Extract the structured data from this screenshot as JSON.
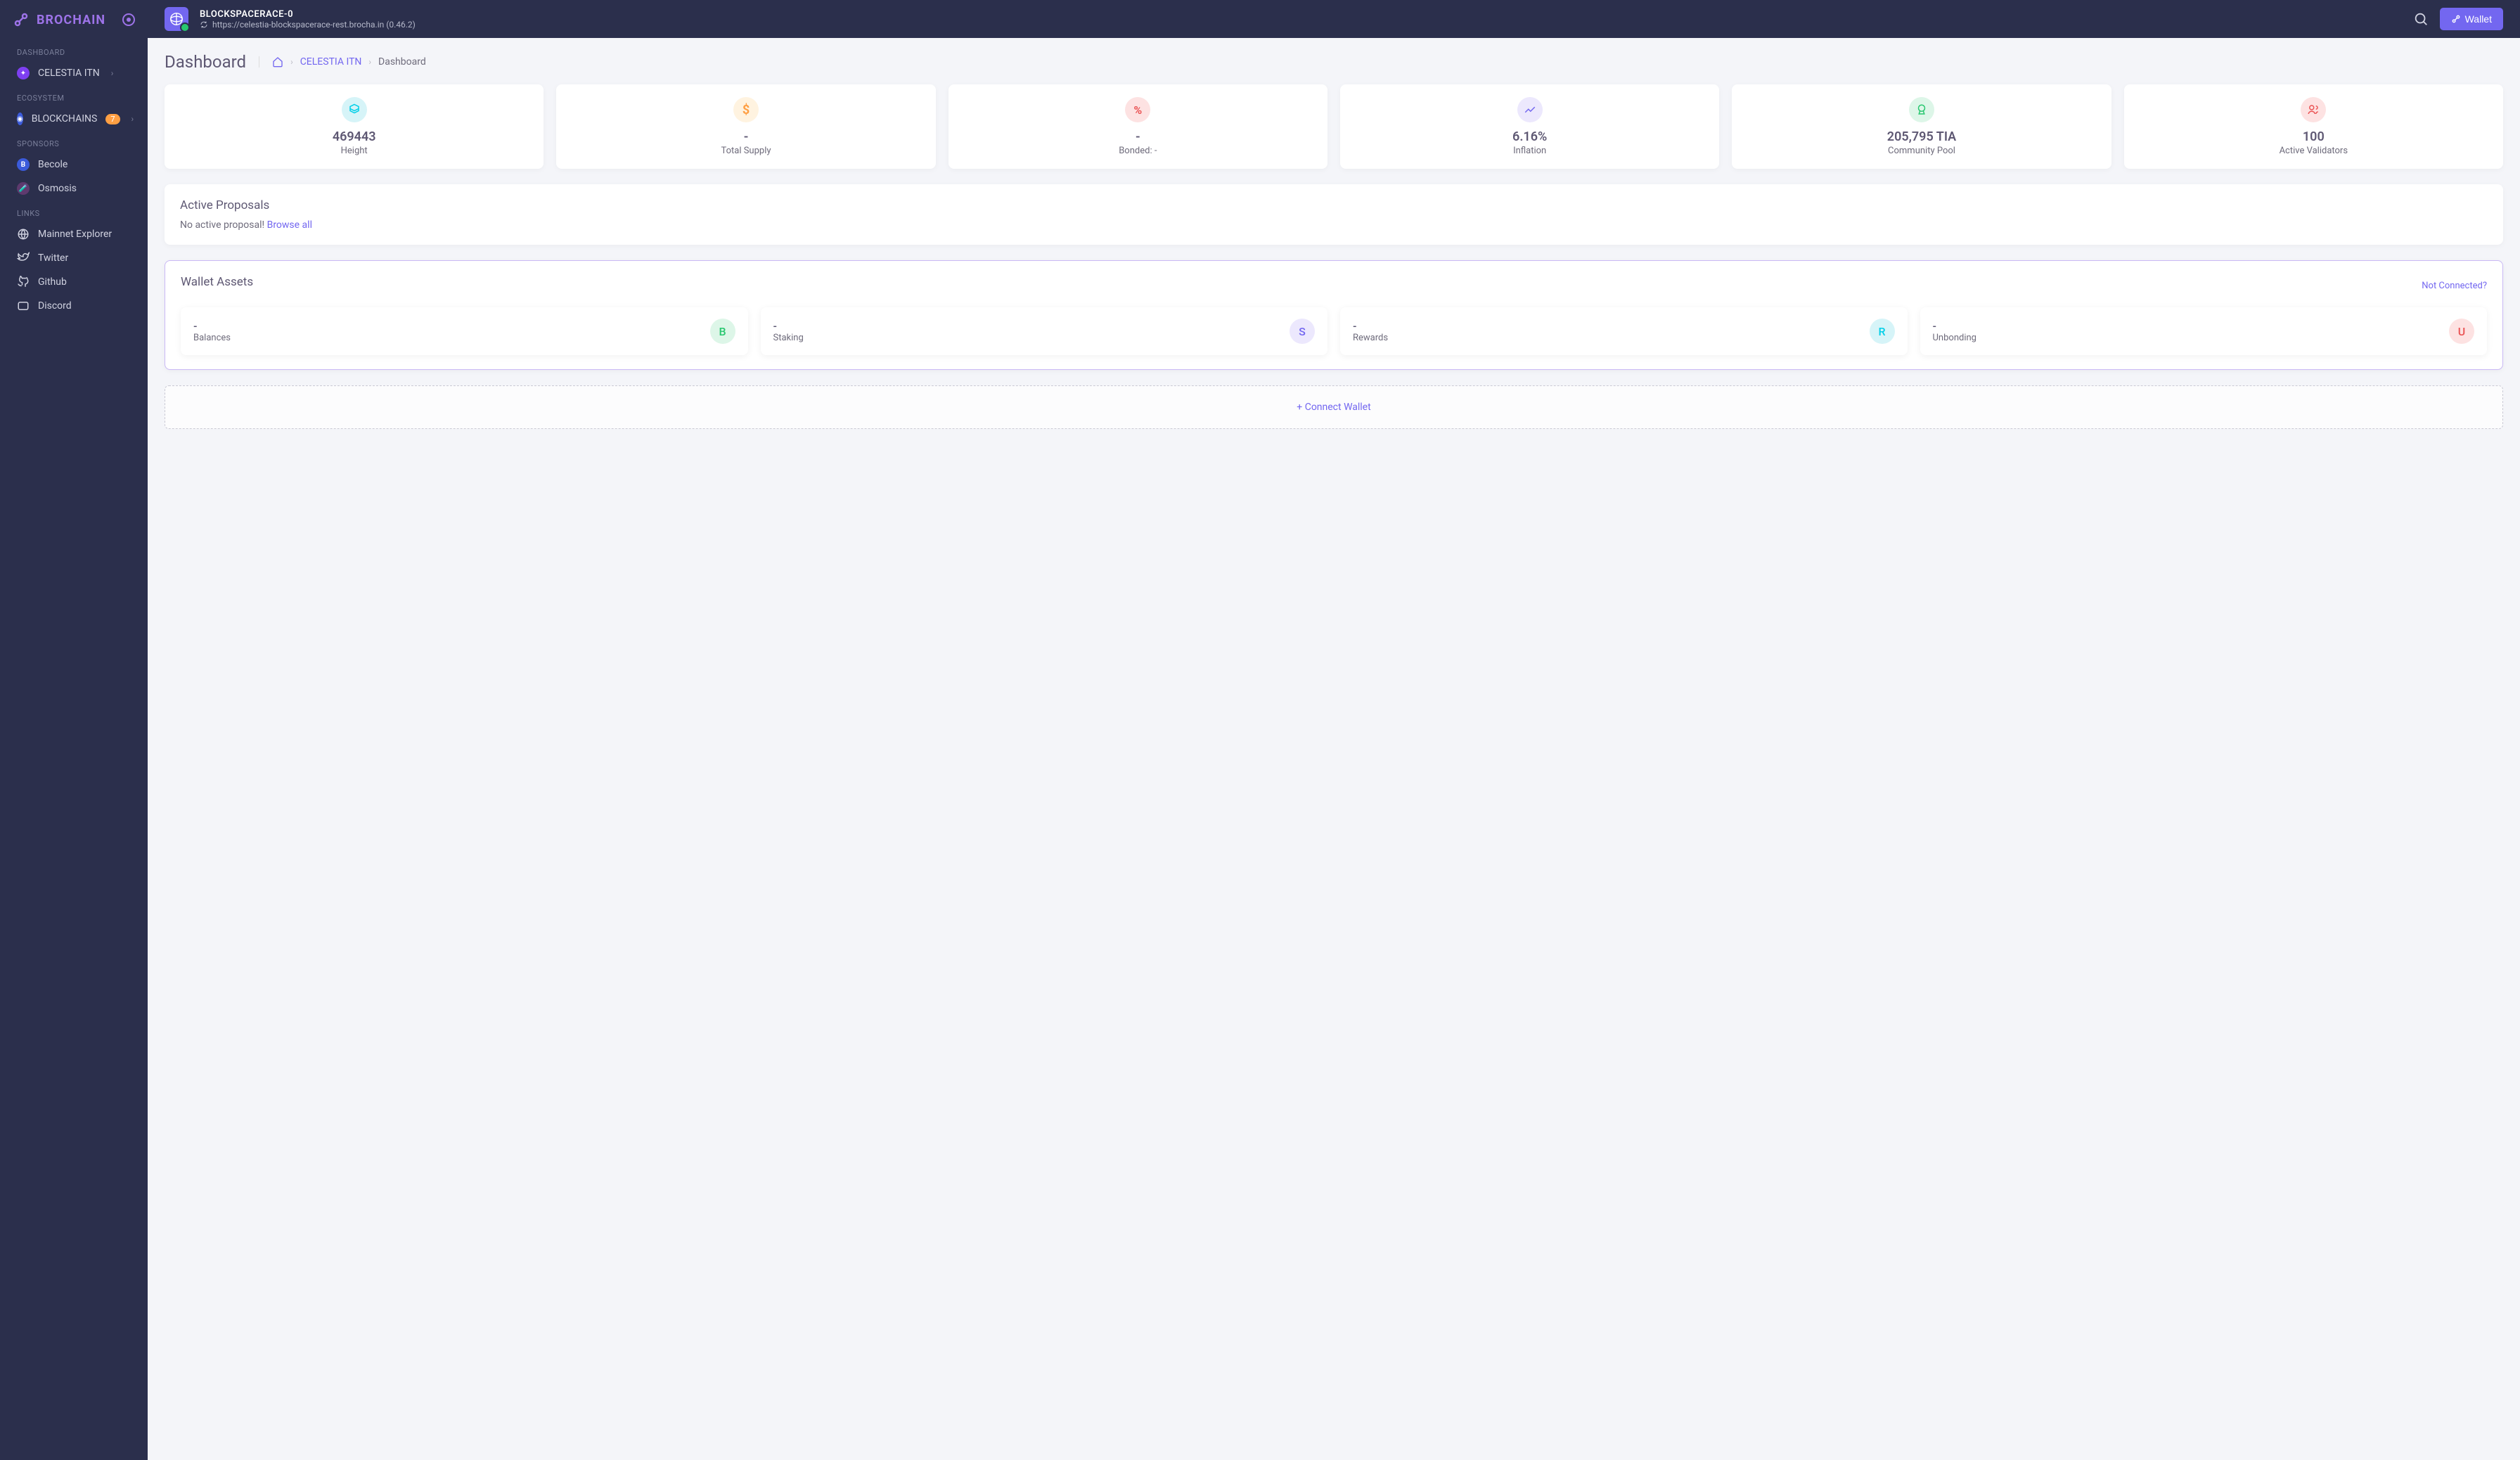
{
  "brand": "BROCHAIN",
  "sidebar": {
    "sections": [
      {
        "heading": "DASHBOARD",
        "items": [
          {
            "label": "CELESTIA ITN",
            "icon": "celestia",
            "chevron": true
          }
        ]
      },
      {
        "heading": "ECOSYSTEM",
        "items": [
          {
            "label": "BLOCKCHAINS",
            "icon": "block",
            "badge": "7",
            "chevron": true
          }
        ]
      },
      {
        "heading": "SPONSORS",
        "items": [
          {
            "label": "Becole",
            "icon": "becole"
          },
          {
            "label": "Osmosis",
            "icon": "osmosis"
          }
        ]
      },
      {
        "heading": "LINKS",
        "items": [
          {
            "label": "Mainnet Explorer",
            "icon": "globe"
          },
          {
            "label": "Twitter",
            "icon": "twitter"
          },
          {
            "label": "Github",
            "icon": "github"
          },
          {
            "label": "Discord",
            "icon": "discord"
          }
        ]
      }
    ]
  },
  "topbar": {
    "chain_id": "BLOCKSPACERACE-0",
    "chain_url": "https://celestia-blockspacerace-rest.brocha.in (0.46.2)",
    "wallet_label": "Wallet"
  },
  "page": {
    "title": "Dashboard",
    "breadcrumb": {
      "link": "CELESTIA ITN",
      "current": "Dashboard"
    }
  },
  "stats": [
    {
      "value": "469443",
      "label": "Height",
      "icon": "height"
    },
    {
      "value": "-",
      "label": "Total Supply",
      "icon": "supply"
    },
    {
      "value": "-",
      "label": "Bonded: -",
      "icon": "bonded"
    },
    {
      "value": "6.16%",
      "label": "Inflation",
      "icon": "inflation"
    },
    {
      "value": "205,795 TIA",
      "label": "Community Pool",
      "icon": "pool"
    },
    {
      "value": "100",
      "label": "Active Validators",
      "icon": "validators"
    }
  ],
  "proposals": {
    "title": "Active Proposals",
    "empty_text": "No active proposal! ",
    "browse_label": "Browse all"
  },
  "wallet": {
    "title": "Wallet Assets",
    "not_connected": "Not Connected?",
    "items": [
      {
        "value": "-",
        "label": "Balances",
        "letter": "B",
        "cls": "av-b"
      },
      {
        "value": "-",
        "label": "Staking",
        "letter": "S",
        "cls": "av-s"
      },
      {
        "value": "-",
        "label": "Rewards",
        "letter": "R",
        "cls": "av-r"
      },
      {
        "value": "-",
        "label": "Unbonding",
        "letter": "U",
        "cls": "av-u"
      }
    ],
    "connect_label": "Connect Wallet"
  }
}
